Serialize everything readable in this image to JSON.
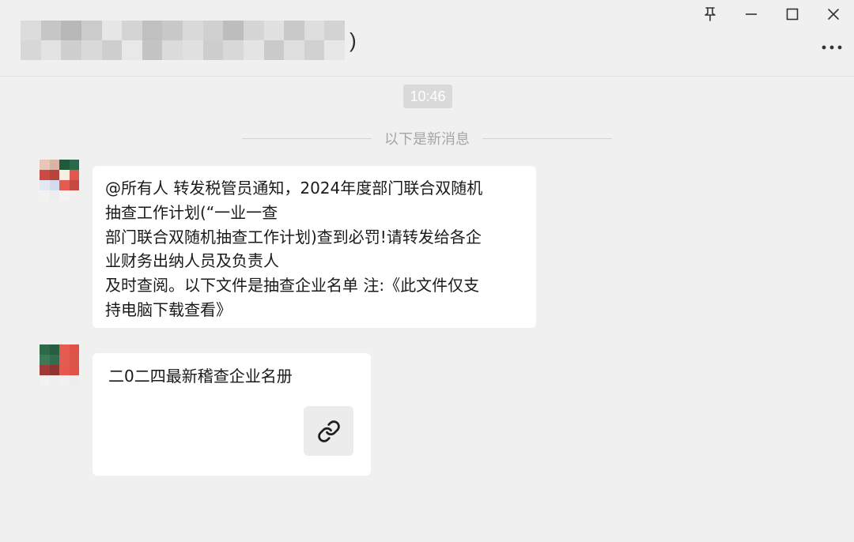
{
  "header": {
    "title_suffix": ")",
    "title_pixels": [
      [
        "#dcdcdc",
        "#c6c6c6",
        "#b8b8b8",
        "#cbcbcb",
        "#e6e6e6",
        "#d4d4d4",
        "#c0c0c0",
        "#c8c8c8",
        "#d9d9d9",
        "#d0d0d0",
        "#bdbdbd",
        "#d6d6d6",
        "#e1e1e1",
        "#c9c9c9",
        "#dedede",
        "#d3d3d3"
      ],
      [
        "#d7d7d7",
        "#e3e3e3",
        "#cfcfcf",
        "#dadada",
        "#cecece",
        "#e8e8e8",
        "#c4c4c4",
        "#dbdbdb",
        "#e0e0e0",
        "#cdcdcd",
        "#d8d8d8",
        "#e4e4e4",
        "#cacaca",
        "#dfdfdf",
        "#d1d1d1",
        "#e7e7e7"
      ]
    ]
  },
  "window_controls": {
    "pin_icon": "pin-icon",
    "minimize_icon": "minimize-icon",
    "maximize_icon": "maximize-icon",
    "close_icon": "close-icon",
    "more_icon": "more-icon"
  },
  "chat": {
    "timestamp": "10:46",
    "new_messages_divider": "以下是新消息",
    "messages": [
      {
        "avatar_pixels": [
          "#e8c7b8",
          "#d9b3a5",
          "#1f5a3c",
          "#2a6a48",
          "#c94b44",
          "#b8433d",
          "#f4f0e6",
          "#e0594f",
          "#e3e8f2",
          "#d2dcec",
          "#e55a52",
          "#c44a43",
          "#f2f2f2",
          "#eeeeee",
          "#f3f3f3",
          "#f0f0f0"
        ],
        "lines": [
          "@所有人 转发税管员通知，2024年度部门联合双随机",
          "抽查工作计划(“一业一查",
          "部门联合双随机抽查工作计划)查到必罚!请转发给各企",
          "业财务出纳人员及负责人",
          "及时查阅。以下文件是抽查企业名单 注:《此文件仅支",
          "持电脑下载查看》"
        ]
      },
      {
        "avatar_pixels": [
          "#2e6a4a",
          "#285f42",
          "#e65a50",
          "#e05248",
          "#3a7a55",
          "#326e4d",
          "#e35b51",
          "#dc554b",
          "#9e3a38",
          "#8f3432",
          "#e7594f",
          "#de5249",
          "#f2f2f2",
          "#efefef",
          "#f1f1f1",
          "#ededed"
        ],
        "file_title": "二0二四最新稽查企业名册",
        "link_icon": "link-icon"
      }
    ]
  },
  "colors": {
    "background": "#f0f0f0",
    "bubble": "#ffffff",
    "timestamp_bg": "#dadada",
    "divider_text": "#a6a6a6"
  }
}
